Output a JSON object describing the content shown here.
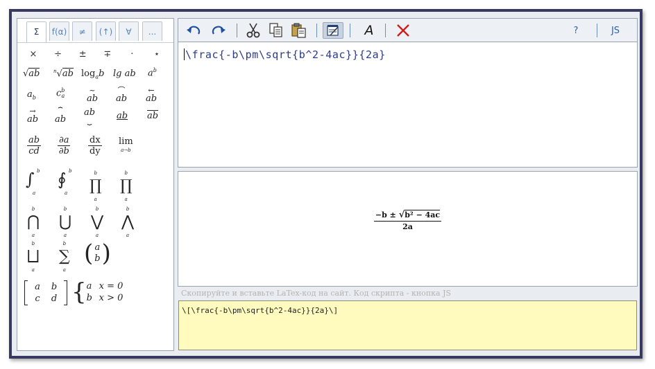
{
  "tabs": [
    {
      "label": "Σ",
      "active": true
    },
    {
      "label": "f(α)",
      "active": false
    },
    {
      "label": "≠",
      "active": false
    },
    {
      "label": "(↑)",
      "active": false
    },
    {
      "label": "∀",
      "active": false
    },
    {
      "label": "...",
      "active": false
    }
  ],
  "operators": [
    "×",
    "÷",
    "±",
    "∓",
    "·",
    "⋆"
  ],
  "symbols": {
    "sqrt": "ab",
    "nroot_n": "n",
    "nroot": "ab",
    "log": "log",
    "log_sub": "a",
    "log_arg": "b",
    "lg": "lg ab",
    "pow_base": "a",
    "pow_exp": "b",
    "sub_base": "a",
    "sub_idx": "b",
    "tensor_base": "c",
    "tensor_up": "b",
    "tensor_low": "a",
    "tilde": "ab",
    "arc": "ab",
    "larrow": "ab",
    "rarrow": "ab",
    "overbrace": "ab",
    "underbrace": "ab",
    "underline": "ab",
    "overline": "ab",
    "frac_n": "ab",
    "frac_d": "cd",
    "pd_n": "∂a",
    "pd_d": "∂b",
    "dx_n": "dx",
    "dx_d": "dy",
    "lim": "lim",
    "lim_sub": "a→b",
    "int": "∫",
    "oint": "∮",
    "prod": "∏",
    "coprod": "∐",
    "bigcap": "⋂",
    "bigcup": "⋃",
    "bigvee": "⋁",
    "bigwedge": "⋀",
    "bigsqcup": "⨆",
    "sum": "∑",
    "lim_a": "a",
    "lim_b": "b",
    "binom_top": "a",
    "binom_bot": "b",
    "matrix": [
      [
        "a",
        "b"
      ],
      [
        "c",
        "d"
      ]
    ],
    "cases": [
      [
        "a",
        "x = 0"
      ],
      [
        "b",
        "x > 0"
      ]
    ]
  },
  "toolbar": {
    "undo": "undo",
    "redo": "redo",
    "cut": "cut",
    "copy": "copy",
    "paste": "paste",
    "format": "format",
    "font_label": "A",
    "clear": "clear",
    "help_label": "?",
    "js_label": "JS"
  },
  "editor": {
    "code": "\\frac{-b\\pm\\sqrt{b^2-4ac}}{2a}"
  },
  "preview": {
    "numerator_prefix": "−b ± ",
    "sqrt_content": "b² − 4ac",
    "denominator": "2a"
  },
  "hint": "Скопируйте и вставьте LaTex-код на сайт. Код скрипта - кнопка JS",
  "output": {
    "code": "\\[\\frac{-b\\pm\\sqrt{b^2-4ac}}{2a}\\]"
  },
  "colors": {
    "frame": "#37395e",
    "output_bg": "#fffbbf",
    "code": "#2b3a8c",
    "clear_icon": "#d11a1a"
  }
}
